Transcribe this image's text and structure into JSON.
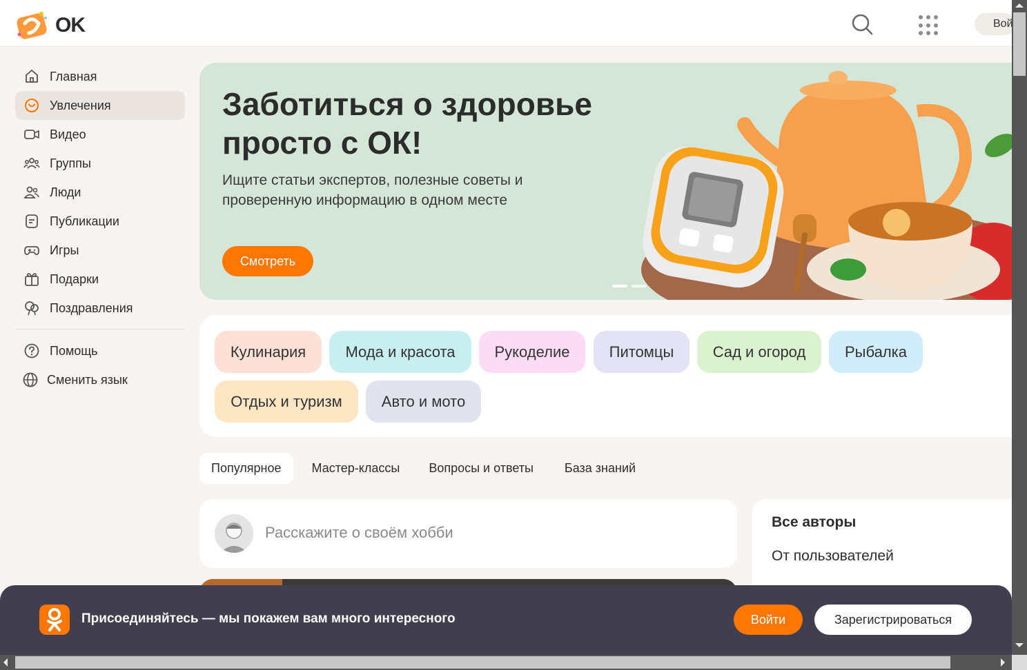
{
  "header": {
    "logo_text": "OK",
    "login_label": "Войти",
    "icons": [
      "search-icon",
      "apps-grid-icon"
    ]
  },
  "sidebar": {
    "items": [
      {
        "label": "Главная",
        "icon": "home-icon"
      },
      {
        "label": "Увлечения",
        "icon": "heart-circle-icon",
        "active": true
      },
      {
        "label": "Видео",
        "icon": "video-icon"
      },
      {
        "label": "Группы",
        "icon": "groups-icon"
      },
      {
        "label": "Люди",
        "icon": "people-icon"
      },
      {
        "label": "Публикации",
        "icon": "publications-icon"
      },
      {
        "label": "Игры",
        "icon": "gamepad-icon"
      },
      {
        "label": "Подарки",
        "icon": "gift-icon"
      },
      {
        "label": "Поздравления",
        "icon": "balloons-icon"
      }
    ],
    "secondary": [
      {
        "label": "Помощь",
        "icon": "help-icon"
      },
      {
        "label": "Сменить язык",
        "icon": "globe-icon"
      }
    ]
  },
  "banner": {
    "title": "Заботиться о здоровье просто с ОК!",
    "subtitle": "Ищите статьи экспертов, полезные советы и проверенную информацию в одном месте",
    "cta": "Смотреть",
    "slides_total": 2
  },
  "categories": [
    {
      "label": "Кулинария",
      "color": "#fde0d6"
    },
    {
      "label": "Мода и красота",
      "color": "#c8eff0"
    },
    {
      "label": "Рукоделие",
      "color": "#fbdcf4"
    },
    {
      "label": "Питомцы",
      "color": "#e3e3f5"
    },
    {
      "label": "Сад и огород",
      "color": "#daf2cf"
    },
    {
      "label": "Рыбалка",
      "color": "#d1ecfb"
    },
    {
      "label": "Отдых и туризм",
      "color": "#fde6c3"
    },
    {
      "label": "Авто и мото",
      "color": "#e1e4ee"
    }
  ],
  "tabs": [
    "Популярное",
    "Мастер-классы",
    "Вопросы и ответы",
    "База знаний"
  ],
  "composer": {
    "placeholder": "Расскажите о своём хобби"
  },
  "authors": {
    "title": "Все авторы",
    "items": [
      "От пользователей"
    ]
  },
  "joinbar": {
    "message": "Присоединяйтесь — мы покажем вам много интересного",
    "login": "Войти",
    "register": "Зарегистрироваться"
  },
  "colors": {
    "accent": "#ff7700",
    "joinbar_bg": "#413e50",
    "banner_bg": "#d4e6d8"
  }
}
